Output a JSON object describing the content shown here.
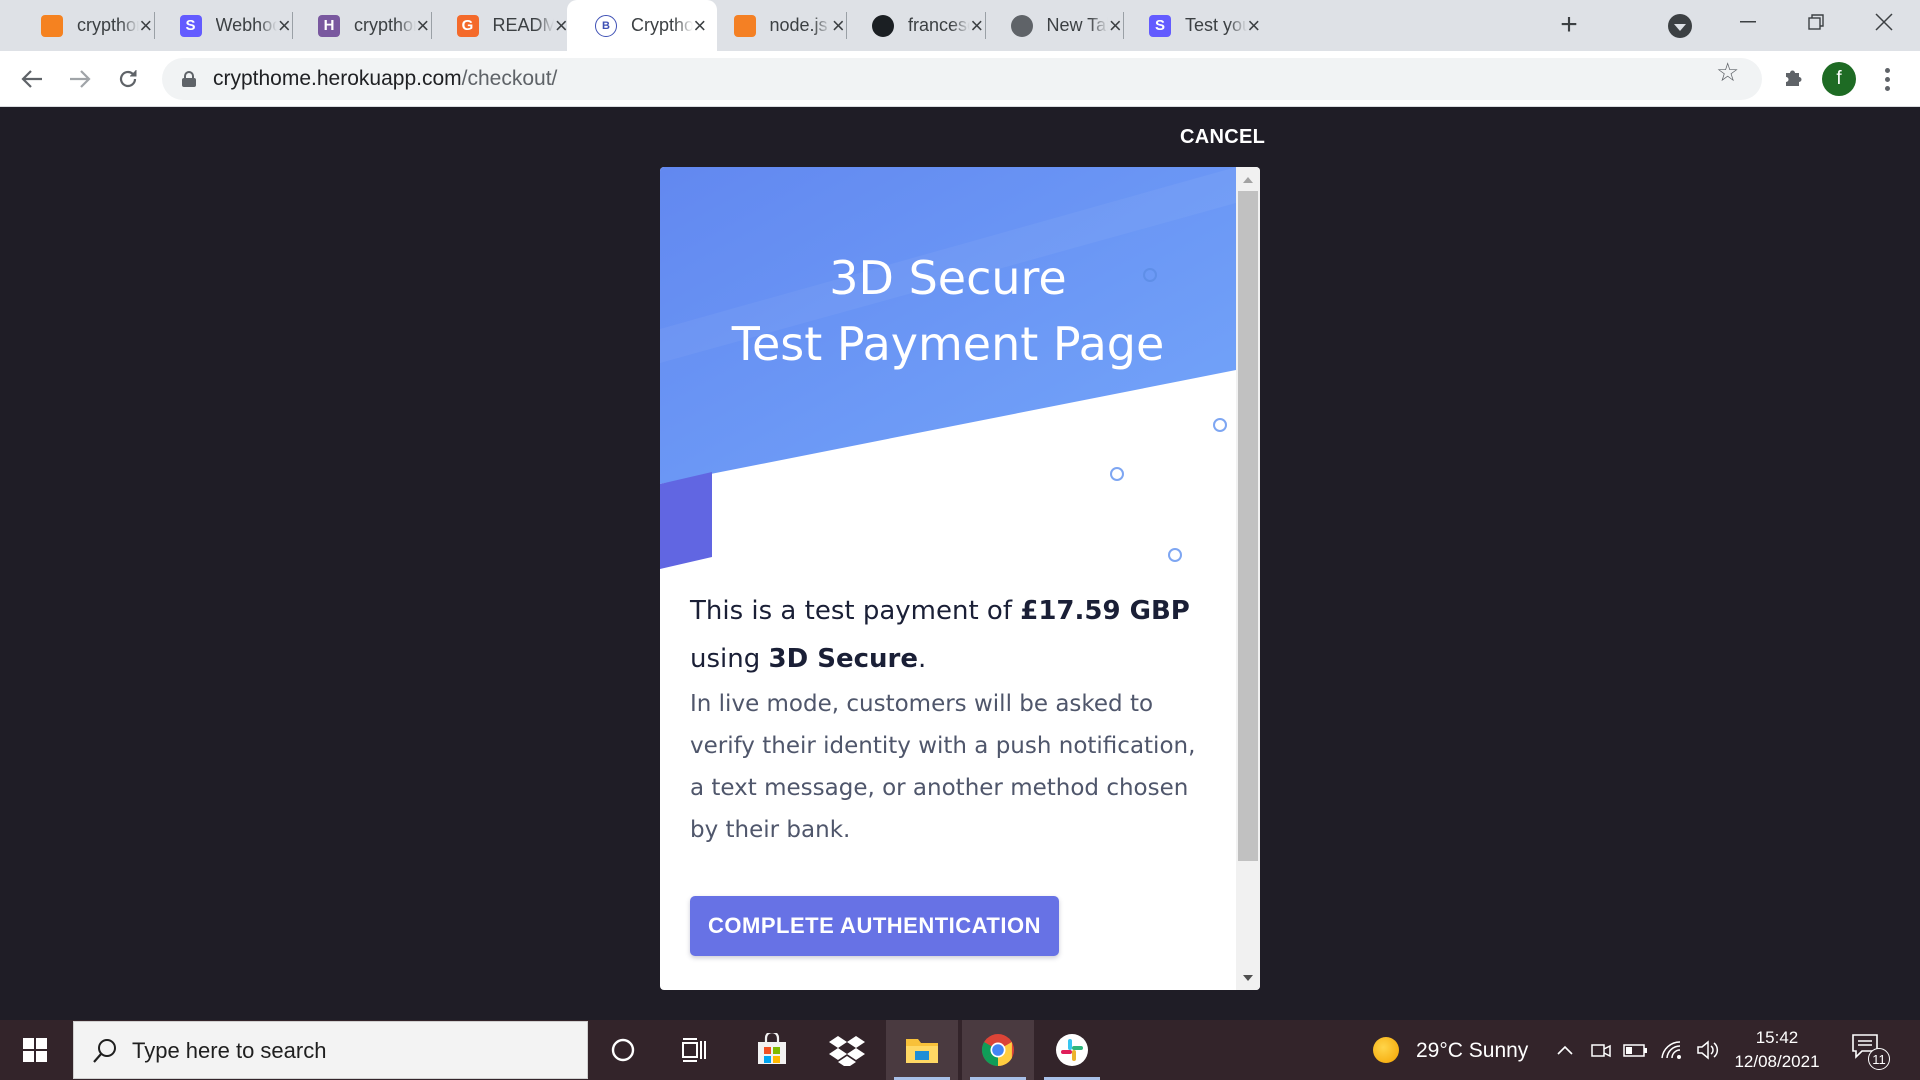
{
  "browser": {
    "tabs": [
      {
        "title": "crypthome",
        "favicon": "orange-box-icon",
        "color": "#f58220",
        "glyph": ""
      },
      {
        "title": "Webhooks",
        "favicon": "stripe-icon",
        "color": "#635bff",
        "glyph": "S"
      },
      {
        "title": "crypthome",
        "favicon": "heroku-icon",
        "color": "#79589f",
        "glyph": "H"
      },
      {
        "title": "README",
        "favicon": "gitbook-icon",
        "color": "#f46a2b",
        "glyph": "G"
      },
      {
        "title": "Crypthome",
        "favicon": "crypthome-icon",
        "color": "#3f51b5",
        "glyph": "B"
      },
      {
        "title": "node.js - ",
        "favicon": "stackoverflow-icon",
        "color": "#f48024",
        "glyph": ""
      },
      {
        "title": "francesco",
        "favicon": "github-icon",
        "color": "#1b1f23",
        "glyph": ""
      },
      {
        "title": "New Tab",
        "favicon": "chrome-icon",
        "color": "#5f6368",
        "glyph": ""
      },
      {
        "title": "Test your",
        "favicon": "stripe-icon",
        "color": "#635bff",
        "glyph": "S"
      }
    ],
    "active_tab": 4,
    "url_host": "crypthome.herokuapp.com",
    "url_path": "/checkout/",
    "profile_initial": "f",
    "profile_color": "#1e6b24"
  },
  "page": {
    "cancel_label": "CANCEL",
    "hero_title_line1": "3D Secure",
    "hero_title_line2": "Test Payment Page",
    "lead_prefix": "This is a test payment of ",
    "amount": "£17.59 GBP",
    "lead_middle": " using ",
    "method": "3D Secure",
    "lead_suffix": ".",
    "description": "In live mode, customers will be asked to verify their identity with a push notification, a text message, or another method chosen by their bank.",
    "button_label": "COMPLETE AUTHENTICATION",
    "accent_color": "#6772e5",
    "hero_color": "#6b9cf5"
  },
  "taskbar": {
    "search_placeholder": "Type here to search",
    "weather": "29°C  Sunny",
    "time": "15:42",
    "date": "12/08/2021",
    "notification_count": "11",
    "apps": [
      "cortana-icon",
      "task-view-icon",
      "store-icon",
      "dropbox-icon",
      "file-explorer-icon",
      "chrome-icon",
      "slack-icon"
    ]
  }
}
